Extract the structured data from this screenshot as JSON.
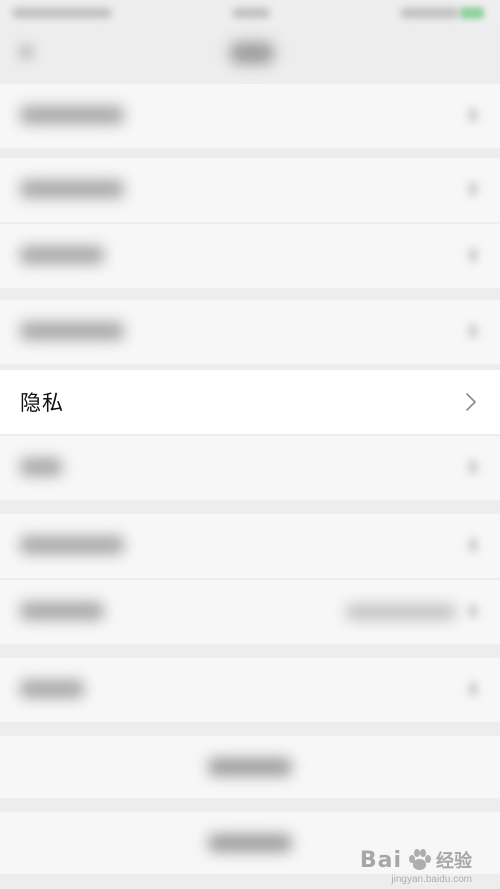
{
  "focused_item": {
    "label": "隐私",
    "chevron_icon": "chevron-right-icon"
  },
  "watermark": {
    "brand": "Bai",
    "brand_tail": "经验",
    "url": "jingyan.baidu.com"
  },
  "colors": {
    "background": "#ededed",
    "row_background": "#f7f7f7",
    "focused_row_background": "#ffffff",
    "label_text": "#111111"
  }
}
